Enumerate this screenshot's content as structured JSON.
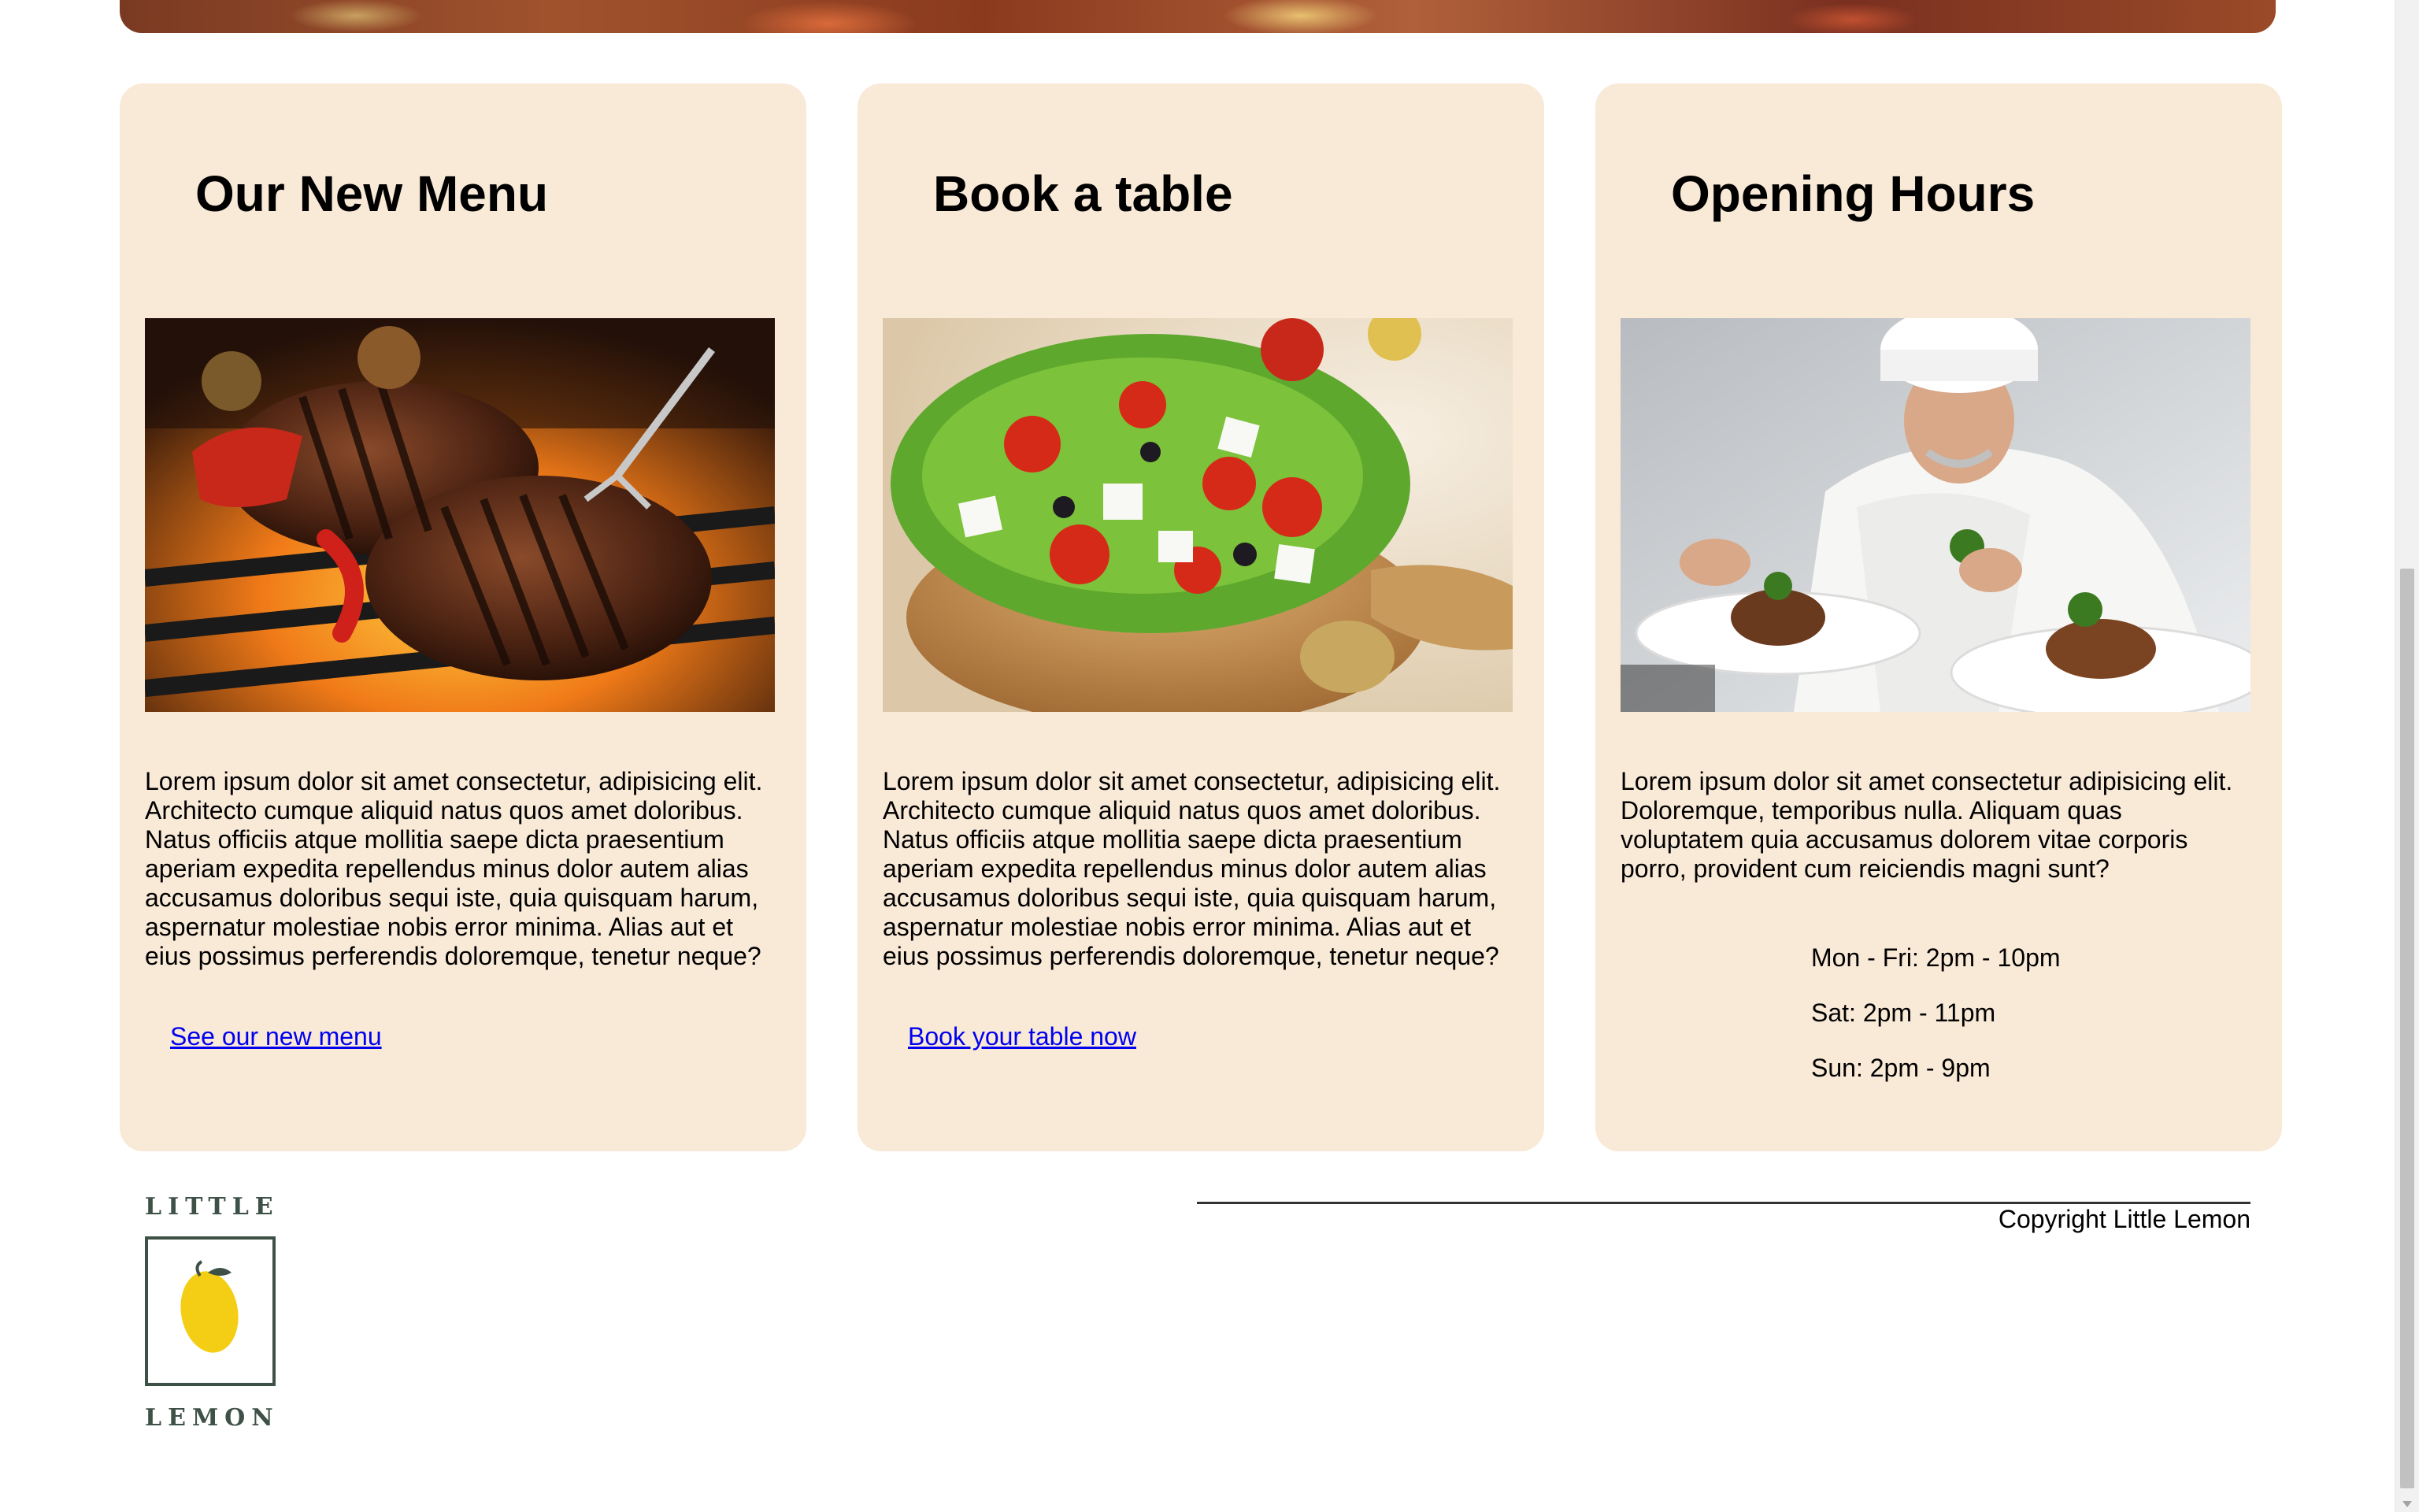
{
  "cards": [
    {
      "title": "Our New Menu",
      "image": "grilled-steak-photo",
      "body": "Lorem ipsum dolor sit amet consectetur, adipisicing elit. Architecto cumque aliquid natus quos amet doloribus. Natus officiis atque mollitia saepe dicta praesentium aperiam expedita repellendus minus dolor autem alias accusamus doloribus sequi iste, quia quisquam harum, aspernatur molestiae nobis error minima. Alias aut et eius possimus perferendis doloremque, tenetur neque?",
      "link": "See our new menu"
    },
    {
      "title": "Book a table",
      "image": "greek-salad-photo",
      "body": "Lorem ipsum dolor sit amet consectetur, adipisicing elit. Architecto cumque aliquid natus quos amet doloribus. Natus officiis atque mollitia saepe dicta praesentium aperiam expedita repellendus minus dolor autem alias accusamus doloribus sequi iste, quia quisquam harum, aspernatur molestiae nobis error minima. Alias aut et eius possimus perferendis doloremque, tenetur neque?",
      "link": "Book your table now"
    },
    {
      "title": "Opening Hours",
      "image": "chef-plating-photo",
      "body": "Lorem ipsum dolor sit amet consectetur adipisicing elit. Doloremque, temporibus nulla. Aliquam quas voluptatem quia accusamus dolorem vitae corporis porro, provident cum reiciendis magni sunt?",
      "hours": [
        "Mon - Fri: 2pm - 10pm",
        "Sat: 2pm - 11pm",
        "Sun: 2pm - 9pm"
      ]
    }
  ],
  "footer": {
    "logo_top": "LITTLE",
    "logo_bottom": "LEMON",
    "copyright": "Copyright Little Lemon"
  },
  "colors": {
    "card_background": "#f9e9d7",
    "link": "#0000ee",
    "logo_green": "#3d5147",
    "lemon_yellow": "#f4ce14"
  }
}
